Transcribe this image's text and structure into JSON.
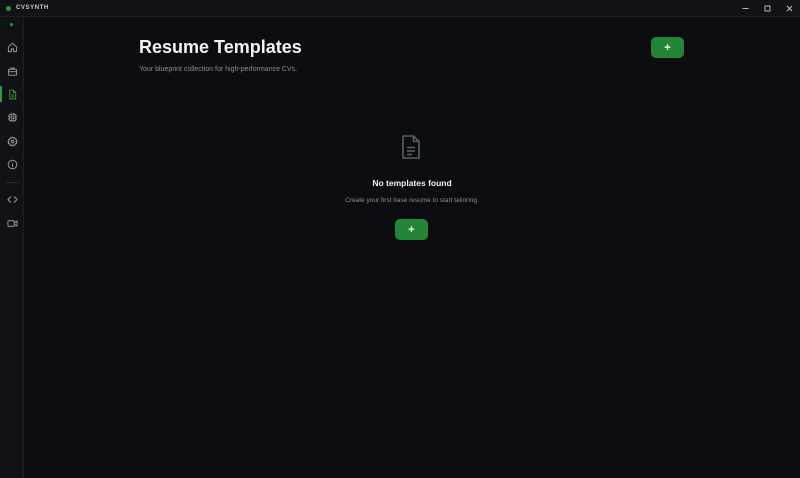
{
  "app": {
    "title": "CVSYNTH"
  },
  "window_controls": {
    "minimize": "─",
    "maximize": "☐",
    "close": "✕"
  },
  "sidebar": {
    "items": [
      {
        "name": "home",
        "icon": "home-icon"
      },
      {
        "name": "jobs",
        "icon": "briefcase-icon"
      },
      {
        "name": "templates",
        "icon": "file-icon",
        "active": true
      },
      {
        "name": "processor",
        "icon": "cpu-icon"
      },
      {
        "name": "settings",
        "icon": "gear-icon"
      },
      {
        "name": "info",
        "icon": "info-icon"
      },
      {
        "name": "code",
        "icon": "code-icon"
      },
      {
        "name": "video",
        "icon": "video-icon"
      }
    ]
  },
  "header": {
    "title": "Resume Templates",
    "subtitle": "Your blueprint collection for high-performance CVs.",
    "add_label": "+"
  },
  "empty_state": {
    "icon": "document-icon",
    "title": "No templates found",
    "message": "Create your first base resume to start tailoring.",
    "add_label": "+"
  },
  "colors": {
    "accent": "#238636",
    "background": "#0c0d10",
    "sidebar": "#111216",
    "muted_text": "#8a8e97"
  }
}
